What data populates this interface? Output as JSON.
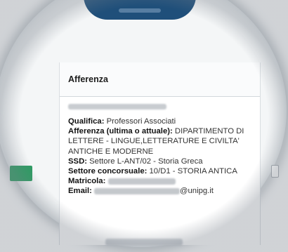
{
  "table": {
    "header": "Afferenza"
  },
  "details": {
    "qualifica_label": "Qualifica:",
    "qualifica_value": "Professori Associati",
    "afferenza_label": "Afferenza (ultima o attuale):",
    "afferenza_value": "DIPARTIMENTO DI LETTERE - LINGUE,LETTERATURE E CIVILTA' ANTICHE E MODERNE",
    "ssd_label": "SSD:",
    "ssd_value": "Settore L-ANT/02 - Storia Greca",
    "settore_label": "Settore concorsuale:",
    "settore_value": "10/D1 - STORIA ANTICA",
    "matricola_label": "Matricola:",
    "email_label": "Email:",
    "email_value_suffix": "@unipg.it"
  }
}
